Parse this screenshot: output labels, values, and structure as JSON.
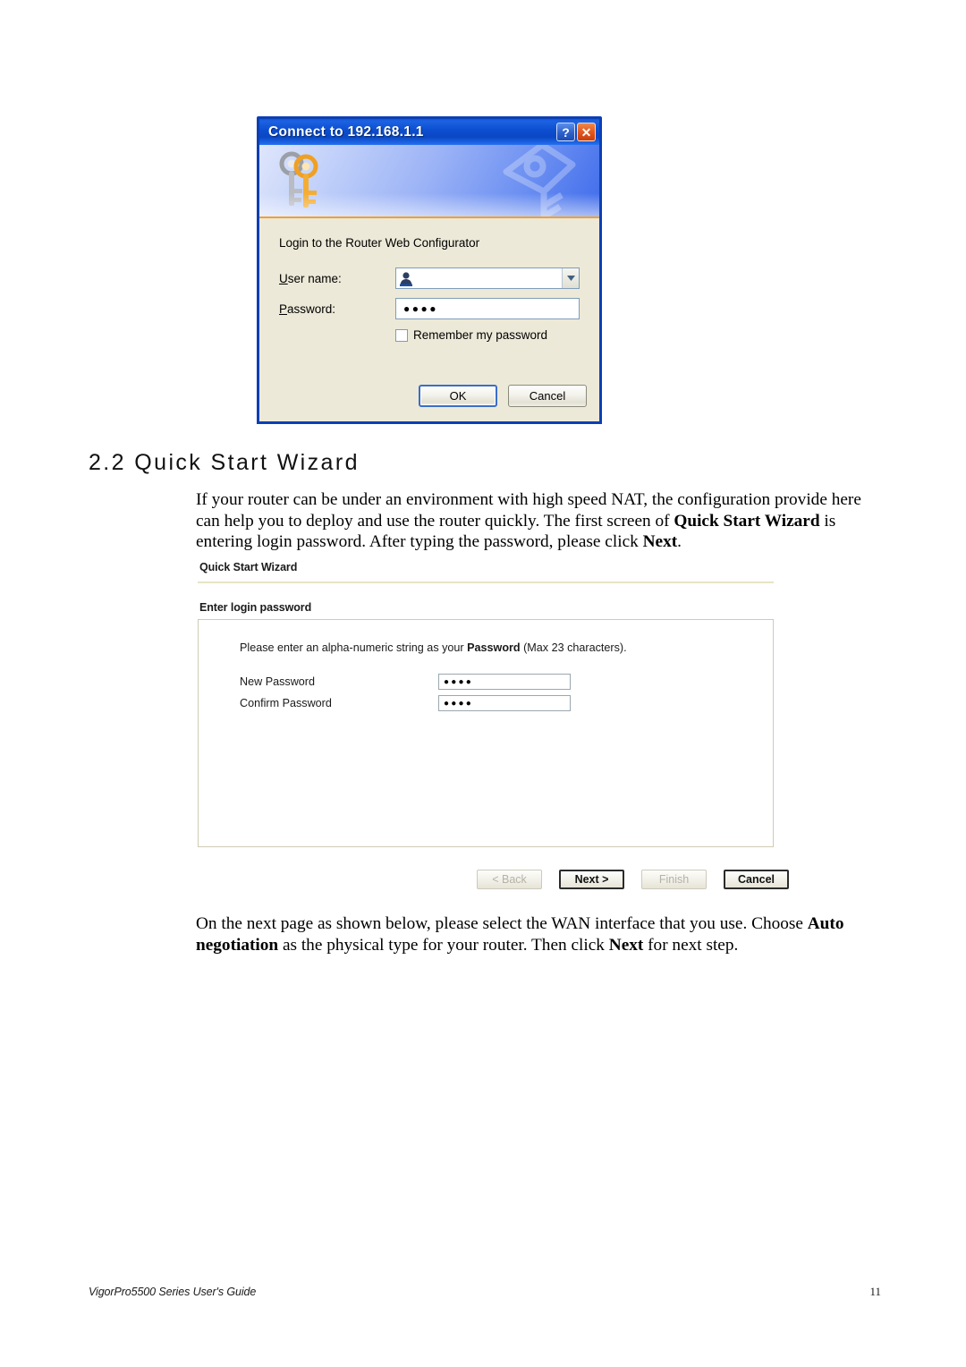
{
  "document": {
    "section_number_title": "2.2 Quick Start Wizard",
    "paragraph_1": {
      "p1": "If your router can be under an environment with high speed NAT, the configuration provide here can help you to deploy and use the router quickly. The first screen of ",
      "b1": "Quick Start Wizard",
      "p2": " is entering login password. After typing the password, please click ",
      "b2": "Next",
      "p3": "."
    },
    "paragraph_2": {
      "p1": "On the next page as shown below, please select the WAN interface that you use. Choose ",
      "b1": "Auto negotiation",
      "p2": " as the physical type for your router. Then click ",
      "b2": "Next",
      "p3": " for next step."
    },
    "footer": {
      "guide_name": "VigorPro5500 Series User's Guide",
      "page_number": "11"
    }
  },
  "xp_dialog": {
    "title": "Connect to 192.168.1.1",
    "help_button_glyph": "?",
    "close_button_glyph": "✕",
    "prompt": "Login to the Router Web Configurator",
    "username": {
      "label": "User name:",
      "label_accesskey": "U",
      "value": "",
      "placeholder": ""
    },
    "password": {
      "label": "Password:",
      "label_accesskey": "P",
      "value": "●●●●",
      "placeholder": ""
    },
    "remember_checkbox": {
      "label": "Remember my password",
      "checked": false
    },
    "ok_label": "OK",
    "cancel_label": "Cancel",
    "colors": {
      "titlebar_blue": "#0d4ed0",
      "dialog_face": "#ece9d8",
      "border_blue": "#0b3fb5",
      "close_orange": "#e2581f",
      "banner_accent": "#f0a030",
      "field_border": "#7f9db9"
    }
  },
  "wizard": {
    "title": "Quick Start Wizard",
    "section_header": "Enter login password",
    "note": {
      "p1": "Please enter an alpha-numeric string as your  ",
      "b1": "Password",
      "p2": " (Max 23 characters)."
    },
    "fields": [
      {
        "label": "New Password",
        "value": "●●●●",
        "placeholder": ""
      },
      {
        "label": "Confirm Password",
        "value": "●●●●",
        "placeholder": ""
      }
    ],
    "buttons": [
      {
        "label": "< Back",
        "state": "disabled"
      },
      {
        "label": "Next >",
        "state": "default"
      },
      {
        "label": "Finish",
        "state": "disabled"
      },
      {
        "label": "Cancel",
        "state": "enabled"
      }
    ],
    "colors": {
      "divider": "#e8e3c4",
      "panel_border": "#cfcbb4",
      "input_border": "#9aa7b0"
    }
  }
}
